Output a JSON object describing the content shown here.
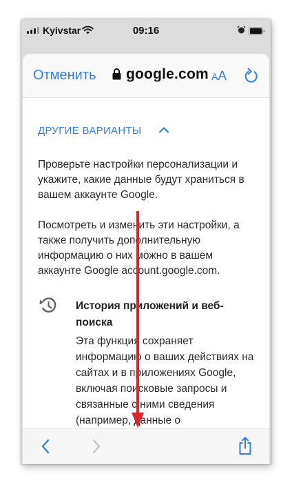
{
  "status_bar": {
    "carrier": "Kyivstar",
    "time": "09:16"
  },
  "nav": {
    "cancel_label": "Отменить",
    "url": "google.com",
    "text_size_small": "A",
    "text_size_big": "A"
  },
  "content": {
    "section_title": "ДРУГИЕ ВАРИАНТЫ",
    "paragraph1": "Проверьте настройки персонализации и укажите, какие данные будут храниться в вашем аккаунте Google.",
    "paragraph2": "Посмотреть и изменить эти настройки, а также получить дополнительную информацию о них можно в вашем аккаунте Google account.google.com.",
    "item_title": "История приложений и веб-поиска",
    "item_desc": "Эта функция сохраняет информацию о ваших действиях на сайтах и в приложениях Google, включая поисковые запросы и связанные с ними сведения (например, данные о"
  },
  "colors": {
    "accent": "#2f7fe6",
    "arrow": "#d9262b"
  },
  "icons": [
    "signal-icon",
    "wifi-icon",
    "alarm-icon",
    "battery-icon",
    "lock-icon",
    "reload-icon",
    "chevron-up-icon",
    "history-icon",
    "back-icon",
    "forward-icon",
    "share-icon"
  ]
}
